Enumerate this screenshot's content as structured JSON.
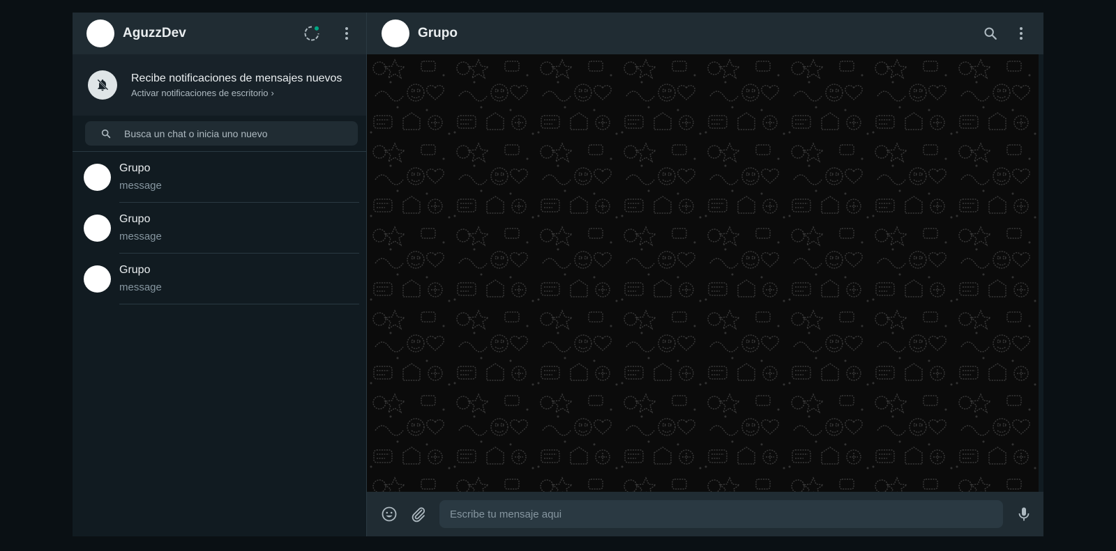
{
  "sidebar": {
    "user_name": "AguzzDev",
    "icons": [
      "status-icon",
      "menu-icon"
    ],
    "notification": {
      "title": "Recibe notificaciones de mensajes nuevos",
      "link": "Activar notificaciones de escritorio",
      "chevron": "›",
      "icon": "bell-off-icon"
    },
    "search": {
      "placeholder": "Busca un chat o inicia uno nuevo",
      "value": ""
    },
    "chats": [
      {
        "name": "Grupo",
        "message": "message"
      },
      {
        "name": "Grupo",
        "message": "message"
      },
      {
        "name": "Grupo",
        "message": "message"
      }
    ]
  },
  "conversation": {
    "title": "Grupo",
    "icons": [
      "search-icon",
      "menu-icon"
    ],
    "composer": {
      "placeholder": "Escribe tu mensaje aqui",
      "value": "",
      "icons": [
        "emoji-icon",
        "attach-icon",
        "mic-icon"
      ]
    }
  },
  "colors": {
    "background": "#0a1014",
    "panel": "#111b21",
    "header": "#202c33",
    "accent": "#00a884",
    "text": "#e9edef",
    "muted": "#8696a0"
  }
}
